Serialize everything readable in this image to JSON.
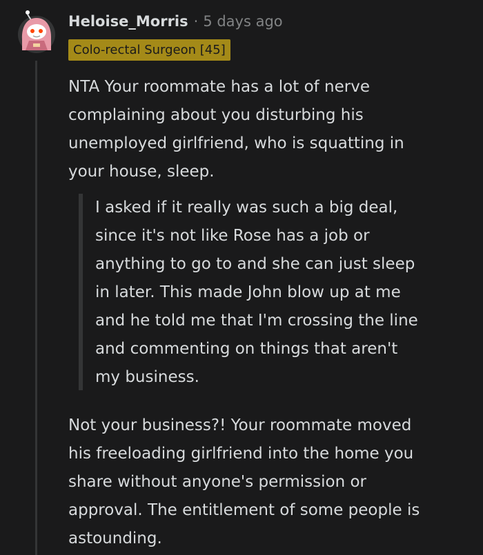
{
  "comment": {
    "avatar_icon": "snoo-pink-hood-avatar-icon",
    "username": "Heloise_Morris",
    "separator": "·",
    "timestamp": "5 days ago",
    "flair": "Colo-rectal Surgeon [45]",
    "flair_color": "#a48a18",
    "paragraph_1": "NTA Your roommate has a lot of nerve\ncomplaining about you disturbing his\nunemployed girlfriend, who is squatting in\nyour house, sleep.",
    "quote": "I asked if it really was such a big deal,\nsince it's not like Rose has a job or\nanything to go to and she can just sleep\nin later. This made John blow up at me\nand he told me that I'm crossing the line\nand commenting on things that aren't\nmy business.",
    "paragraph_2": "Not your business?! Your roommate moved\nhis freeloading girlfriend into the home you\nshare without anyone's permission or\napproval. The entitlement of some people is\nastounding."
  },
  "colors": {
    "background": "#1a1a1b",
    "text": "#d7dadc",
    "muted": "#818384",
    "thread_line": "#343536"
  }
}
